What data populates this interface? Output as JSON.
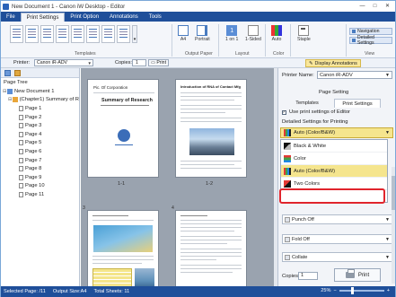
{
  "window": {
    "title": "New Document 1 - Canon iW Desktop - Editor",
    "minimize": "—",
    "maximize": "□",
    "close": "✕"
  },
  "ribbon": {
    "tabs": [
      "File",
      "Print Settings",
      "Print Option",
      "Annotations",
      "Tools"
    ],
    "active_tab": "Print Settings",
    "groups": {
      "templates": "Templates",
      "output_paper": "Output Paper",
      "layout": "Layout",
      "color": "Color",
      "view": "View"
    },
    "buttons": {
      "paper_size": "A4",
      "orientation": "Portrait",
      "pages_per_sheet": "1 on 1",
      "sided": "1-Sided",
      "color_mode": "Auto",
      "staple": "Staple",
      "navigation": "Navigation",
      "detailed_settings": "Detailed Settings"
    },
    "more": "▾"
  },
  "toolbar": {
    "printer_label": "Printer:",
    "printer_value": "Canon iR-ADV",
    "copies_label": "Copies:",
    "copies_value": "1",
    "print_label": "Print",
    "display_annotations": "Display Annotations"
  },
  "page_tree": {
    "title": "Page Tree",
    "document": "New Document 1",
    "chapter": "(Chapter1) Summary of R",
    "pages": [
      "Page 1",
      "Page 2",
      "Page 3",
      "Page 4",
      "Page 5",
      "Page 6",
      "Page 7",
      "Page 8",
      "Page 9",
      "Page 10",
      "Page 11"
    ]
  },
  "document": {
    "page_labels": [
      "1-1",
      "1-2"
    ],
    "page_numbers": [
      "3",
      "4"
    ],
    "page1_company": "Pic. Of Corporation",
    "page1_title": "Summary of Research",
    "page2_title": "Introduction of RNA of Contact Mfg"
  },
  "right_panel": {
    "printer_name_label": "Printer Name:",
    "printer_name_value": "Canon iR-ADV",
    "section_title": "Page Setting",
    "tabs": [
      "Templates",
      "Print Settings"
    ],
    "active_tab": "Print Settings",
    "use_editor_label": "Use print settings of Editor",
    "use_editor_checked": true,
    "detailed_label": "Detailed Settings for Printing",
    "color_selected": "Auto (Color/B&W)",
    "color_options": [
      "Black & White",
      "Color",
      "Auto (Color/B&W)",
      "Two Colors"
    ],
    "highlighted_option": "Two Colors",
    "punch_value": "Punch Off",
    "fold_value": "Fold Off",
    "collate_value": "Collate",
    "copies_label": "Copies:",
    "copies_value": "1",
    "print_label": "Print"
  },
  "status": {
    "selected_page": "Selected Page: /11",
    "output_size": "Output Size:A4",
    "total_sheets": "Total Sheets: 11",
    "zoom": "25%"
  },
  "colors": {
    "title_blue": "#1f4f9a",
    "highlight_yellow": "#f5e58e",
    "highlight_red": "#e0242c"
  }
}
